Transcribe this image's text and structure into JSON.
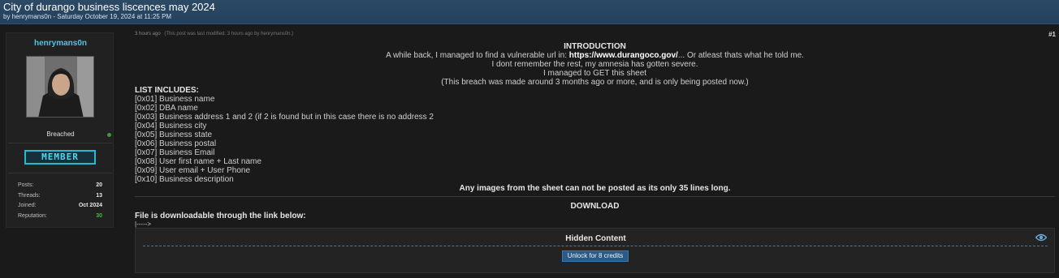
{
  "thread": {
    "title": "City of durango business liscences may 2024",
    "meta": "by henrymans0n - Saturday October 19, 2024 at 11:25 PM"
  },
  "author": {
    "name": "henrymans0n",
    "status": "Breached",
    "rank": "MEMBER",
    "stats": [
      {
        "label": "Posts:",
        "value": "20"
      },
      {
        "label": "Threads:",
        "value": "13"
      },
      {
        "label": "Joined:",
        "value": "Oct 2024"
      },
      {
        "label": "Reputation:",
        "value": "30"
      }
    ]
  },
  "post": {
    "time": "3 hours ago",
    "edited": "(This post was last modified: 3 hours ago by henrymans0n.)",
    "number": "#1",
    "intro_heading": "INTRODUCTION",
    "intro_line1_pre": "A while back, I managed to find a vulnerable url in: ",
    "intro_url": "https://www.durangoco.gov/",
    "intro_line1_post": "... Or atleast thats what he told me.",
    "intro_line2": "I dont remember the rest, my amnesia has gotten severe.",
    "intro_line3": "I managed to GET this sheet",
    "intro_line4": "(This breach was made around 3 months ago or more, and is only being posted now.)",
    "list_heading": "LIST INCLUDES:",
    "list_items": [
      "[0x01] Business name",
      "[0x02] DBA name",
      "[0x03] Business address 1 and 2 (if 2 is found but in this case there is no address 2",
      "[0x04] Business city",
      "[0x05] Business state",
      "[0x06] Business postal",
      "[0x07] Business Email",
      "[0x08] User first name + Last name",
      "[0x09] User email + User Phone",
      "[0x10] Business description"
    ],
    "images_note": "Any images from the sheet can not be posted as its only 35 lines long.",
    "download_heading": "DOWNLOAD",
    "download_text": "File is downloadable through the link below:",
    "arrow": "|----->"
  },
  "hidden": {
    "title": "Hidden Content",
    "unlock_label": "Unlock for 8 credits"
  },
  "colors": {
    "header": "#23405c",
    "username": "#4fc3e8",
    "rank_border": "#25b9d3",
    "reputation": "#3cbf3c",
    "unlock_button": "#2a5b86"
  },
  "icons": {
    "status": "online-dot-icon",
    "hidden": "eye-icon"
  }
}
